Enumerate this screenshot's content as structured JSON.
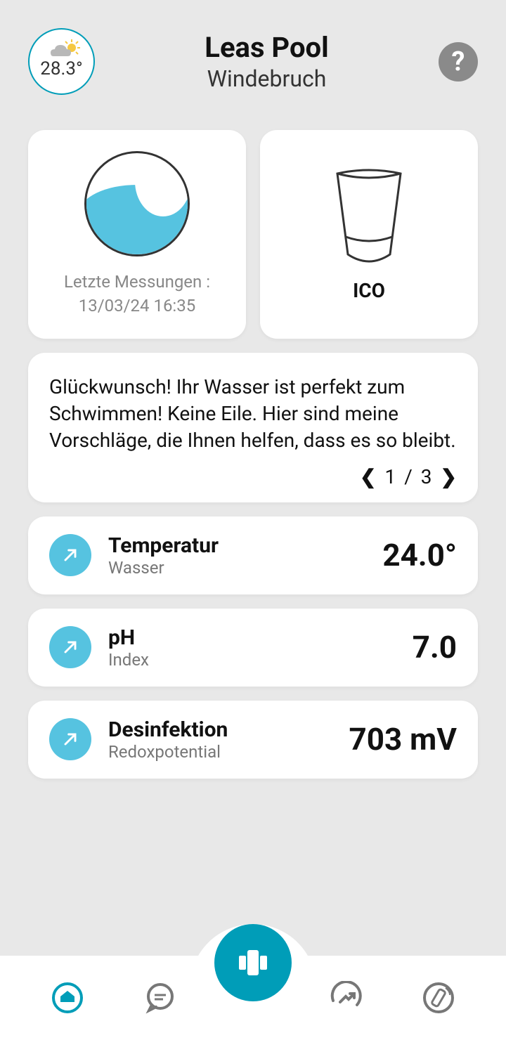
{
  "header": {
    "weather_temp": "28.3°",
    "title": "Leas Pool",
    "subtitle": "Windebruch",
    "help": "?"
  },
  "status_cards": {
    "measurement_label": "Letzte Messungen :",
    "measurement_time": "13/03/24 16:35",
    "device_label": "ICO"
  },
  "message": {
    "text": "Glückwunsch! Ihr Wasser ist perfekt zum Schwimmen! Keine Eile. Hier sind meine Vorschläge, die Ihnen helfen, dass es so bleibt.",
    "page_current": "1",
    "page_sep": "/",
    "page_total": "3"
  },
  "metrics": [
    {
      "title": "Temperatur",
      "sub": "Wasser",
      "value": "24.0°"
    },
    {
      "title": "pH",
      "sub": "Index",
      "value": "7.0"
    },
    {
      "title": "Desinfektion",
      "sub": "Redoxpotential",
      "value": "703 mV"
    }
  ],
  "colors": {
    "accent": "#009db8",
    "icon_bg": "#56c3e0"
  }
}
